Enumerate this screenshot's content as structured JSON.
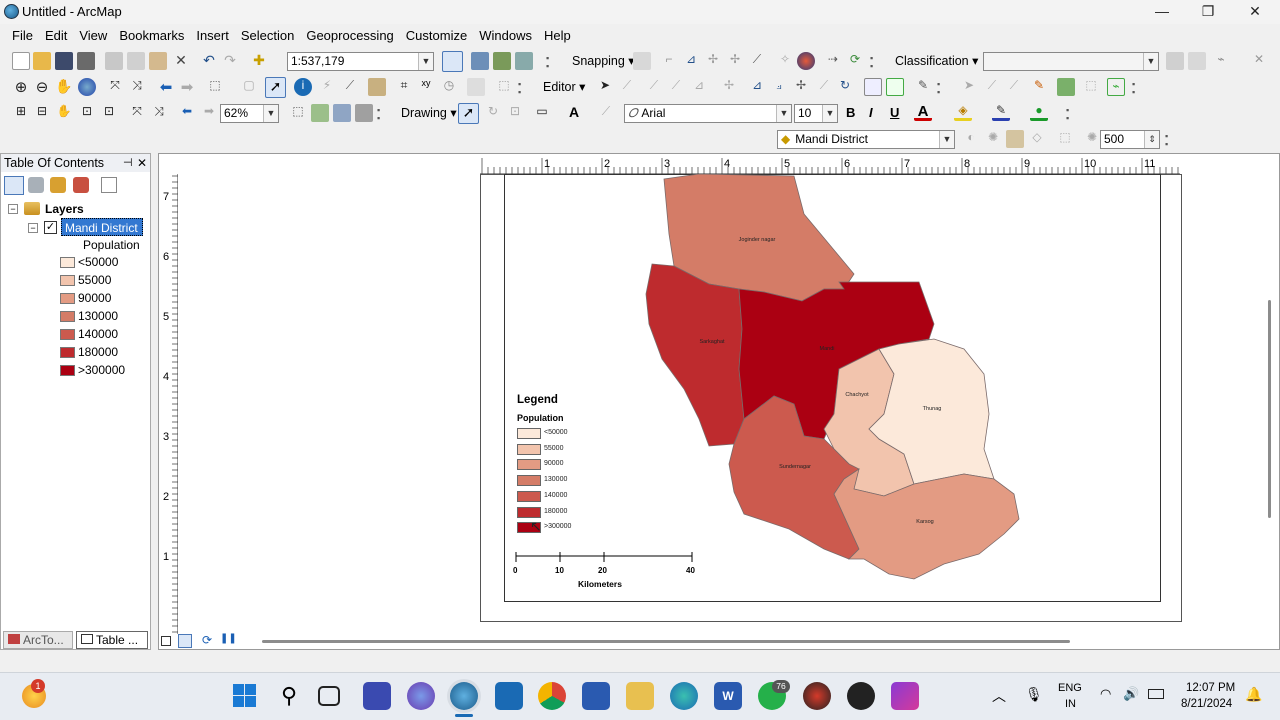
{
  "window": {
    "title": "Untitled - ArcMap",
    "minimize": "—",
    "restore": "❐",
    "close": "✕"
  },
  "menu": [
    "File",
    "Edit",
    "View",
    "Bookmarks",
    "Insert",
    "Selection",
    "Geoprocessing",
    "Customize",
    "Windows",
    "Help"
  ],
  "toolbar": {
    "scale": "1:537,179",
    "snapping_label": "Snapping ▾",
    "classification_label": "Classification ▾",
    "editor_label": "Editor ▾",
    "drawing_label": "Drawing ▾",
    "zoom_value": "62%",
    "font_name": "Arial",
    "font_size": "10",
    "bold": "B",
    "italic": "I",
    "underline": "U",
    "layer_select": "Mandi District",
    "value_500": "500"
  },
  "toc": {
    "title": "Table Of Contents",
    "layers_label": "Layers",
    "layer_name": "Mandi District",
    "field_label": "Population",
    "classes": [
      {
        "label": "<50000",
        "color": "#fce9da"
      },
      {
        "label": "55000",
        "color": "#f2c4ad"
      },
      {
        "label": "90000",
        "color": "#e39b83"
      },
      {
        "label": "130000",
        "color": "#d47c67"
      },
      {
        "label": "140000",
        "color": "#cc5a4e"
      },
      {
        "label": "180000",
        "color": "#be2b2e"
      },
      {
        "label": ">300000",
        "color": "#ab0012"
      }
    ],
    "tab_arctoolbox": "ArcTo...",
    "tab_table": "Table ..."
  },
  "map": {
    "legend_title": "Legend",
    "legend_field": "Population",
    "legend_classes": [
      "<50000",
      "55000",
      "90000",
      "130000",
      "140000",
      "180000",
      ">300000"
    ],
    "scalebar_ticks": [
      "0",
      "10",
      "20",
      "40"
    ],
    "scalebar_unit": "Kilometers",
    "district_labels": [
      "Joginder nagar",
      "Sarkaghat",
      "Mandi",
      "Chachyot",
      "Thunag",
      "Sundernagar",
      "Karsog"
    ],
    "hruler_labels": [
      "1",
      "2",
      "3",
      "4",
      "5",
      "6",
      "7",
      "8",
      "9",
      "10",
      "11"
    ],
    "vruler_labels": [
      "7",
      "6",
      "5",
      "4",
      "3",
      "2",
      "1"
    ]
  },
  "taskbar": {
    "notification_badge": "1",
    "whatsapp_badge": "76",
    "lang": "ENG",
    "region": "IN",
    "time": "12:07 PM",
    "date": "8/21/2024"
  }
}
